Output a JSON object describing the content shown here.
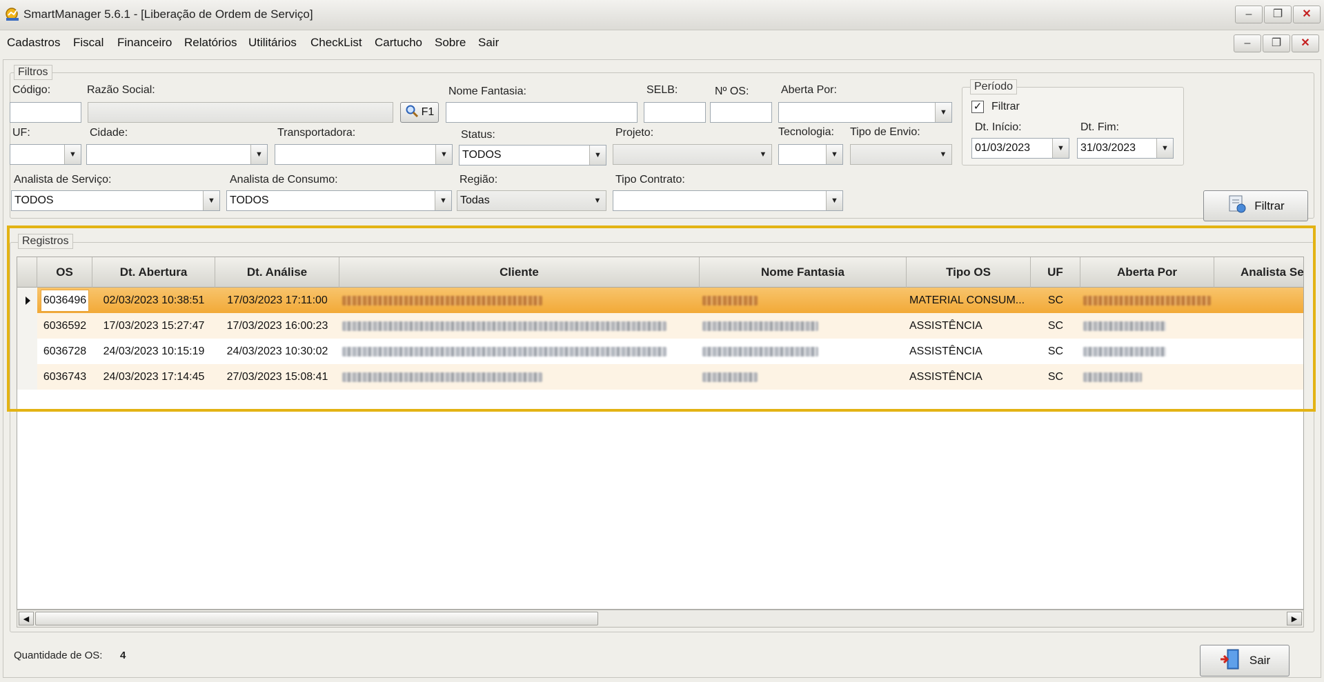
{
  "window": {
    "title": "SmartManager 5.6.1 - [Liberação de Ordem de Serviço]"
  },
  "menu": [
    "Cadastros",
    "Fiscal",
    "Financeiro",
    "Relatórios",
    "Utilitários",
    "CheckList",
    "Cartucho",
    "Sobre",
    "Sair"
  ],
  "filtros": {
    "legend": "Filtros",
    "codigo": {
      "label": "Código:",
      "value": ""
    },
    "razao_social": {
      "label": "Razão Social:",
      "value": ""
    },
    "search_label": "F1",
    "nome_fantasia": {
      "label": "Nome Fantasia:",
      "value": ""
    },
    "selb": {
      "label": "SELB:",
      "value": ""
    },
    "num_os": {
      "label": "Nº OS:",
      "value": ""
    },
    "aberta_por": {
      "label": "Aberta Por:",
      "value": ""
    },
    "uf": {
      "label": "UF:",
      "value": ""
    },
    "cidade": {
      "label": "Cidade:",
      "value": ""
    },
    "transportadora": {
      "label": "Transportadora:",
      "value": ""
    },
    "status": {
      "label": "Status:",
      "value": "TODOS"
    },
    "projeto": {
      "label": "Projeto:",
      "value": ""
    },
    "tecnologia": {
      "label": "Tecnologia:",
      "value": ""
    },
    "tipo_envio": {
      "label": "Tipo de Envio:",
      "value": ""
    },
    "analista_servico": {
      "label": "Analista de Serviço:",
      "value": "TODOS"
    },
    "analista_consumo": {
      "label": "Analista de Consumo:",
      "value": "TODOS"
    },
    "regiao": {
      "label": "Região:",
      "value": "Todas"
    },
    "tipo_contrato": {
      "label": "Tipo Contrato:",
      "value": ""
    },
    "periodo": {
      "legend": "Período",
      "filtrar_label": "Filtrar",
      "filtrar_checked": true,
      "checkbox_mark": "✓",
      "dt_inicio": {
        "label": "Dt. Início:",
        "value": "01/03/2023"
      },
      "dt_fim": {
        "label": "Dt. Fim:",
        "value": "31/03/2023"
      }
    },
    "filtrar_button": "Filtrar"
  },
  "registros": {
    "legend": "Registros",
    "columns": [
      "OS",
      "Dt. Abertura",
      "Dt. Análise",
      "Cliente",
      "Nome Fantasia",
      "Tipo OS",
      "UF",
      "Aberta Por",
      "Analista Se"
    ],
    "rows": [
      {
        "os": "6036496",
        "dt_abertura": "02/03/2023 10:38:51",
        "dt_analise": "17/03/2023 17:11:00",
        "tipo_os": "MATERIAL  CONSUM...",
        "uf": "SC"
      },
      {
        "os": "6036592",
        "dt_abertura": "17/03/2023 15:27:47",
        "dt_analise": "17/03/2023 16:00:23",
        "tipo_os": "ASSISTÊNCIA",
        "uf": "SC"
      },
      {
        "os": "6036728",
        "dt_abertura": "24/03/2023 10:15:19",
        "dt_analise": "24/03/2023 10:30:02",
        "tipo_os": "ASSISTÊNCIA",
        "uf": "SC"
      },
      {
        "os": "6036743",
        "dt_abertura": "24/03/2023 17:14:45",
        "dt_analise": "27/03/2023 15:08:41",
        "tipo_os": "ASSISTÊNCIA",
        "uf": "SC"
      }
    ]
  },
  "footer": {
    "quantidade_label": "Quantidade de OS:",
    "quantidade_value": "4",
    "sair_button": "Sair"
  },
  "colors": {
    "highlight": "#e3b314",
    "selected_row": "#f5b44a",
    "alt_row": "#fdf3e4"
  },
  "icons": [
    "app-logo-icon",
    "minimize-icon",
    "restore-icon",
    "close-icon",
    "search-icon",
    "dropdown-arrow-icon",
    "filter-icon",
    "exit-door-icon",
    "row-pointer-icon"
  ]
}
